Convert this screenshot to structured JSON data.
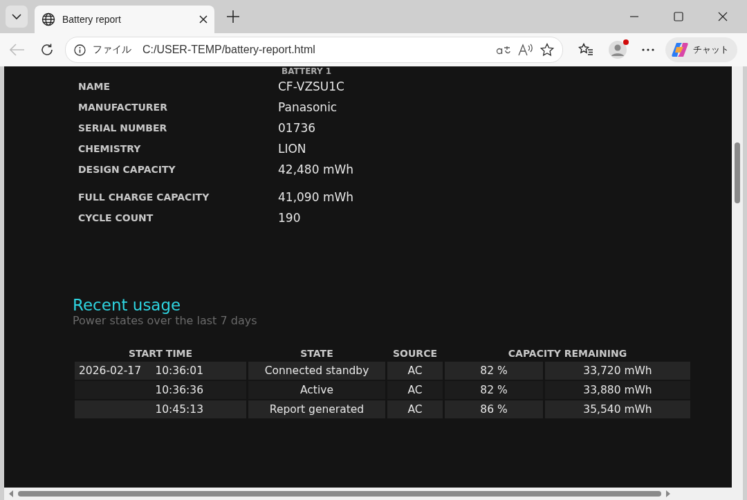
{
  "browser": {
    "tab": {
      "title": "Battery report",
      "selected": true
    },
    "address": {
      "badge": "ファイル",
      "url": "C:/USER-TEMP/battery-report.html"
    },
    "copilot_label": "チャット",
    "profile_notification": true
  },
  "battery": {
    "heading": "BATTERY 1",
    "fields": [
      {
        "label": "NAME",
        "value": "CF-VZSU1C"
      },
      {
        "label": "MANUFACTURER",
        "value": "Panasonic"
      },
      {
        "label": "SERIAL NUMBER",
        "value": "01736"
      },
      {
        "label": "CHEMISTRY",
        "value": "LION"
      },
      {
        "label": "DESIGN CAPACITY",
        "value": "42,480 mWh"
      },
      {
        "label": "FULL CHARGE CAPACITY",
        "value": "41,090 mWh"
      },
      {
        "label": "CYCLE COUNT",
        "value": "190"
      }
    ]
  },
  "recent_usage": {
    "title": "Recent usage",
    "subtitle": "Power states over the last 7 days",
    "columns": [
      "START TIME",
      "STATE",
      "SOURCE",
      "CAPACITY REMAINING"
    ],
    "rows": [
      {
        "date": "2026-02-17",
        "time": "10:36:01",
        "state": "Connected standby",
        "source": "AC",
        "percent": "82 %",
        "energy": "33,720 mWh"
      },
      {
        "time": "10:36:36",
        "state": "Active",
        "source": "AC",
        "percent": "82 %",
        "energy": "33,880 mWh"
      },
      {
        "time": "10:45:13",
        "state": "Report generated",
        "source": "AC",
        "percent": "86 %",
        "energy": "35,540 mWh"
      }
    ]
  }
}
